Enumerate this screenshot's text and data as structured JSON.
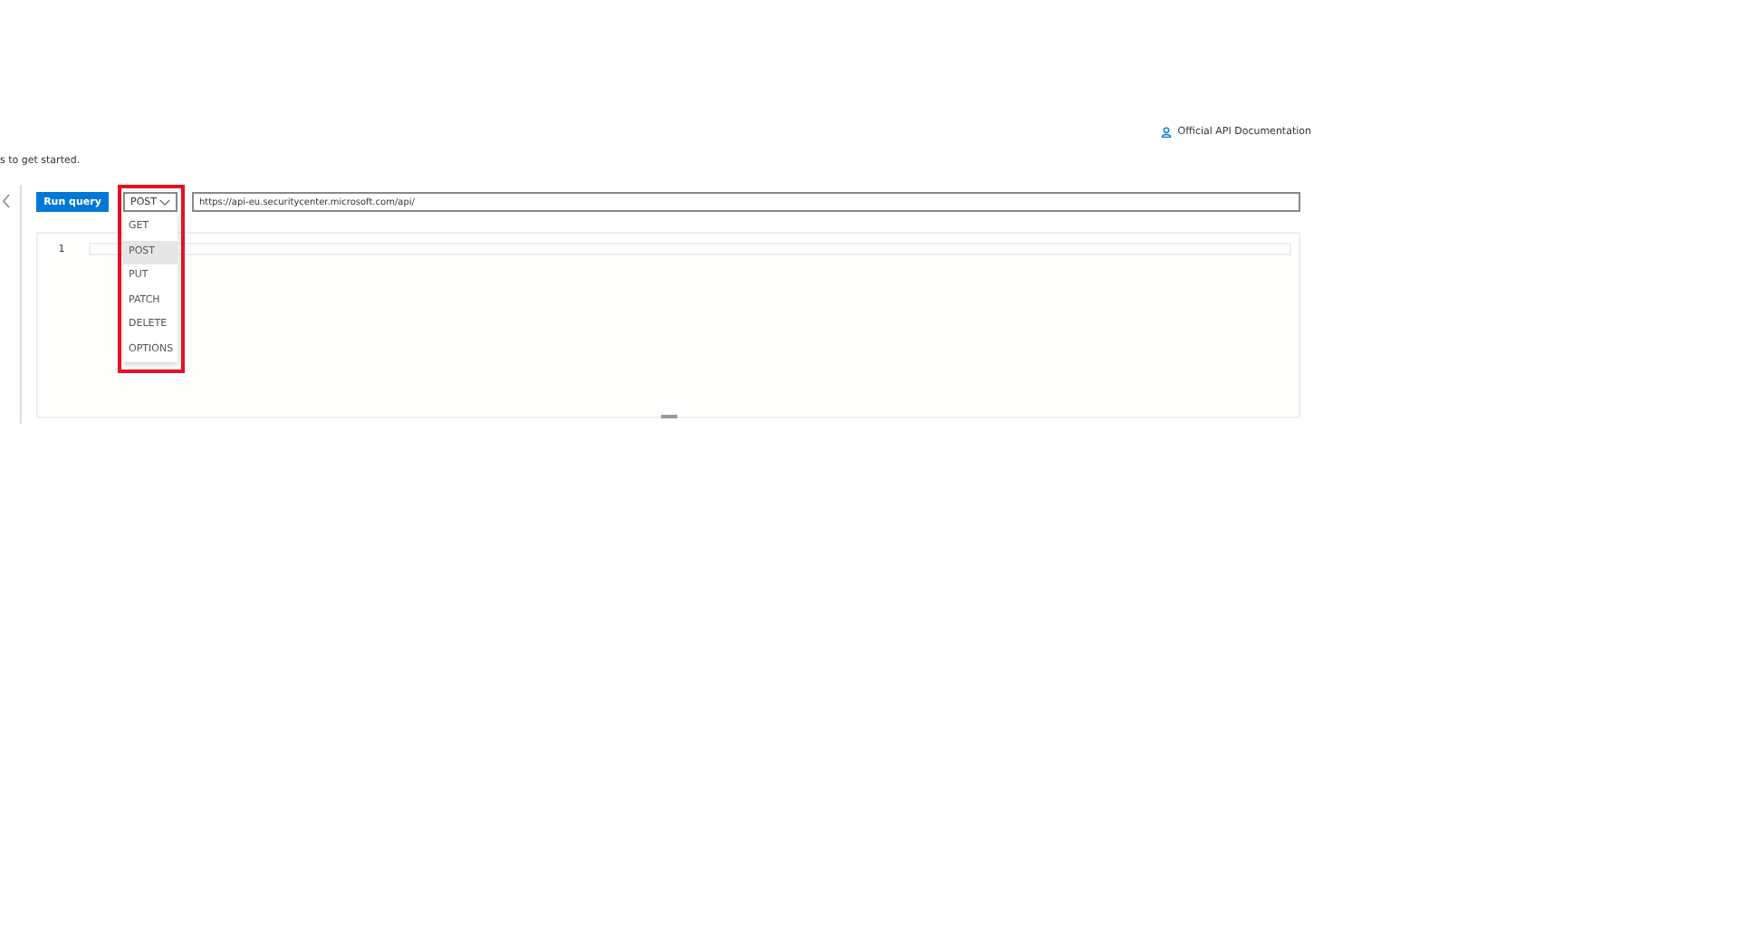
{
  "doc_link": {
    "label": "Official API Documentation"
  },
  "intro": {
    "text": "s to get started."
  },
  "toolbar": {
    "run_button": "Run query",
    "method": {
      "value": "POST",
      "expanded": true
    },
    "url": {
      "value": "https://api-eu.securitycenter.microsoft.com/api/"
    }
  },
  "method_options": [
    {
      "label": "GET",
      "selected": false
    },
    {
      "label": "POST",
      "selected": true
    },
    {
      "label": "PUT",
      "selected": false
    },
    {
      "label": "PATCH",
      "selected": false
    },
    {
      "label": "DELETE",
      "selected": false
    },
    {
      "label": "OPTIONS",
      "selected": false
    }
  ],
  "editor": {
    "line_numbers": [
      "1"
    ]
  },
  "annotation": {
    "kind": "highlight",
    "color": "#e81123"
  }
}
